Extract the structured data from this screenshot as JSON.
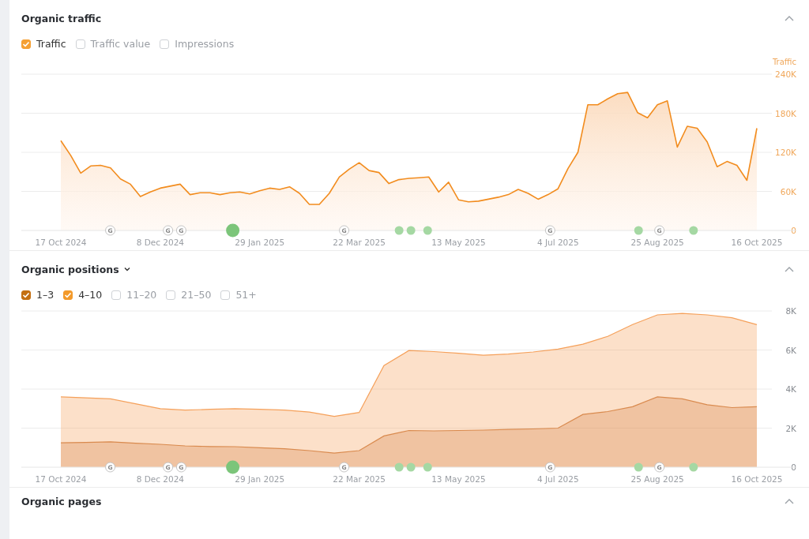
{
  "sections": [
    {
      "title": "Organic traffic",
      "title_dropdown": false,
      "expanded": true,
      "options": [
        {
          "label": "Traffic",
          "checked": true,
          "color": "#f5a033"
        },
        {
          "label": "Traffic value",
          "checked": false
        },
        {
          "label": "Impressions",
          "checked": false
        }
      ],
      "chart_data": {
        "type": "area",
        "ylabel": "Traffic",
        "categories": [
          "17 Oct 2024",
          null,
          null,
          null,
          null,
          null,
          null,
          null,
          null,
          null,
          "8 Dec 2024",
          null,
          null,
          null,
          null,
          null,
          null,
          null,
          null,
          null,
          "29 Jan 2025",
          null,
          null,
          null,
          null,
          null,
          null,
          null,
          null,
          null,
          "22 Mar 2025",
          null,
          null,
          null,
          null,
          null,
          null,
          null,
          null,
          null,
          "13 May 2025",
          null,
          null,
          null,
          null,
          null,
          null,
          null,
          null,
          null,
          "4 Jul 2025",
          null,
          null,
          null,
          null,
          null,
          null,
          null,
          null,
          null,
          "25 Aug 2025",
          null,
          null,
          null,
          null,
          null,
          null,
          null,
          null,
          null,
          "16 Oct 2025"
        ],
        "series": [
          {
            "color": "#f28c1e",
            "values": [
              138000,
              115000,
              88000,
              99000,
              100000,
              96000,
              79000,
              71000,
              52000,
              59000,
              65000,
              68000,
              71000,
              55000,
              58000,
              58000,
              55000,
              58000,
              59000,
              56000,
              61000,
              65000,
              63000,
              67000,
              57000,
              40000,
              40000,
              57000,
              82000,
              94000,
              104000,
              92000,
              89000,
              72000,
              78000,
              80000,
              81000,
              82000,
              59000,
              74000,
              47000,
              44000,
              45000,
              48000,
              51000,
              55000,
              63000,
              57000,
              48000,
              55000,
              64000,
              95000,
              120000,
              193000,
              193000,
              202000,
              210000,
              212000,
              181000,
              173000,
              193000,
              199000,
              128000,
              160000,
              157000,
              136000,
              98000,
              106000,
              100000,
              77000,
              157000
            ]
          }
        ],
        "ylim": [
          0,
          240000
        ],
        "yticks": [
          {
            "value": 0,
            "label": "0"
          },
          {
            "value": 60000,
            "label": "60K"
          },
          {
            "value": 120000,
            "label": "120K"
          },
          {
            "value": 180000,
            "label": "180K"
          },
          {
            "value": 240000,
            "label": "240K"
          }
        ],
        "grid": true
      },
      "events": [
        {
          "level": 0.071,
          "kind": "google",
          "label": "G"
        },
        {
          "level": 0.154,
          "kind": "google",
          "label": "G"
        },
        {
          "level": 0.173,
          "kind": "google",
          "label": "G"
        },
        {
          "level": 0.247,
          "kind": "major"
        },
        {
          "level": 0.407,
          "kind": "google",
          "label": "G"
        },
        {
          "level": 0.486,
          "kind": "minor"
        },
        {
          "level": 0.503,
          "kind": "minor"
        },
        {
          "level": 0.527,
          "kind": "minor"
        },
        {
          "level": 0.703,
          "kind": "google",
          "label": "G"
        },
        {
          "level": 0.83,
          "kind": "minor"
        },
        {
          "level": 0.86,
          "kind": "google",
          "label": "G"
        },
        {
          "level": 0.909,
          "kind": "minor"
        }
      ]
    },
    {
      "title": "Organic positions",
      "title_dropdown": true,
      "expanded": true,
      "options": [
        {
          "label": "1–3",
          "checked": true,
          "color": "#c46f12"
        },
        {
          "label": "4–10",
          "checked": true,
          "color": "#f39a2b"
        },
        {
          "label": "11–20",
          "checked": false
        },
        {
          "label": "21–50",
          "checked": false
        },
        {
          "label": "51+",
          "checked": false
        }
      ],
      "chart_data": {
        "type": "area",
        "categories": [
          "17 Oct 2024",
          null,
          null,
          null,
          "8 Dec 2024",
          null,
          null,
          null,
          "29 Jan 2025",
          null,
          null,
          null,
          "22 Mar 2025",
          null,
          null,
          null,
          "13 May 2025",
          null,
          null,
          null,
          "4 Jul 2025",
          null,
          null,
          null,
          "25 Aug 2025",
          null,
          null,
          null,
          "16 Oct 2025"
        ],
        "series": [
          {
            "color": "#d98a4e",
            "values": [
              1250,
              1270,
              1300,
              1230,
              1170,
              1090,
              1060,
              1050,
              1000,
              940,
              850,
              720,
              850,
              1600,
              1880,
              1860,
              1880,
              1900,
              1930,
              1960,
              2000,
              2700,
              2850,
              3100,
              3600,
              3500,
              3200,
              3050,
              3100
            ]
          },
          {
            "color": "#f5a05a",
            "values": [
              3600,
              3550,
              3500,
              3250,
              3000,
              2920,
              2960,
              3000,
              2960,
              2920,
              2820,
              2600,
              2800,
              5200,
              5970,
              5920,
              5830,
              5730,
              5790,
              5900,
              6050,
              6300,
              6700,
              7300,
              7800,
              7870,
              7800,
              7650,
              7300
            ]
          }
        ],
        "ylim": [
          0,
          8000
        ],
        "yticks": [
          {
            "value": 0,
            "label": "0"
          },
          {
            "value": 2000,
            "label": "2K"
          },
          {
            "value": 4000,
            "label": "4K"
          },
          {
            "value": 6000,
            "label": "6K"
          },
          {
            "value": 8000,
            "label": "8K"
          }
        ],
        "grid": true
      },
      "events": [
        {
          "level": 0.071,
          "kind": "google",
          "label": "G"
        },
        {
          "level": 0.154,
          "kind": "google",
          "label": "G"
        },
        {
          "level": 0.173,
          "kind": "google",
          "label": "G"
        },
        {
          "level": 0.247,
          "kind": "major"
        },
        {
          "level": 0.407,
          "kind": "google",
          "label": "G"
        },
        {
          "level": 0.486,
          "kind": "minor"
        },
        {
          "level": 0.503,
          "kind": "minor"
        },
        {
          "level": 0.527,
          "kind": "minor"
        },
        {
          "level": 0.703,
          "kind": "google",
          "label": "G"
        },
        {
          "level": 0.83,
          "kind": "minor"
        },
        {
          "level": 0.86,
          "kind": "google",
          "label": "G"
        },
        {
          "level": 0.909,
          "kind": "minor"
        }
      ]
    },
    {
      "title": "Organic pages",
      "title_dropdown": false,
      "expanded": true
    }
  ]
}
